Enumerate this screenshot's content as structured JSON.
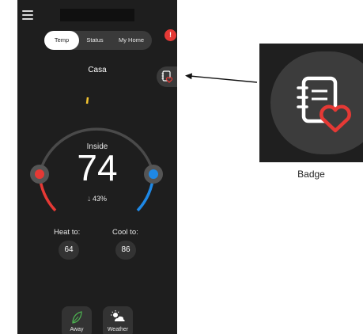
{
  "tabs": [
    {
      "label": "Temp",
      "active": true
    },
    {
      "label": "Status",
      "active": false
    },
    {
      "label": "My Home",
      "active": false
    }
  ],
  "notification": {
    "count": "!",
    "color": "#e53935"
  },
  "location": "Casa",
  "thermostat": {
    "label": "Inside",
    "temperature": "74",
    "humidity": "43%",
    "heat_label": "Heat to:",
    "heat_value": "64",
    "cool_label": "Cool to:",
    "cool_value": "86",
    "heat_color": "#e53935",
    "cool_color": "#1e88e5",
    "indicator_color": "#f4c430"
  },
  "bottom_buttons": [
    {
      "label": "Away",
      "icon": "leaf-icon"
    },
    {
      "label": "Weather",
      "icon": "weather-icon"
    }
  ],
  "callout": {
    "label": "Badge",
    "icon": "notebook-heart-icon"
  }
}
